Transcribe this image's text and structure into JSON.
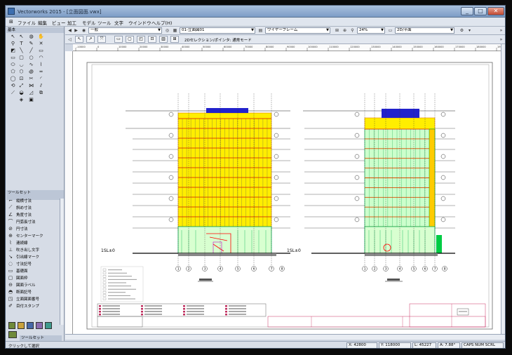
{
  "window": {
    "title": "Vectorworks 2015 - [立面図面.vwx]",
    "btn_min": "_",
    "btn_max": "□",
    "btn_close": "✕"
  },
  "menu": [
    "ファイル",
    "編集",
    "ビュー",
    "加工",
    "モデル",
    "ツール",
    "文字",
    "ウインドウ",
    "ヘルプ(H)"
  ],
  "panels": {
    "basic_title": "基本",
    "toolset_title": "ツールセット",
    "toolset_footer": "ツールセット"
  },
  "toolset_items": [
    "縦横寸法",
    "斜め寸法",
    "角度寸法",
    "円弧長寸法",
    "円寸法",
    "センターマーク",
    "連続線",
    "吹き出し文字",
    "引出線マーク",
    "寸法記号",
    "基礎面",
    "図面枠",
    "図面ラベル",
    "断面記号",
    "立面図面番号",
    "目付スタンプ"
  ],
  "toolbar": {
    "class": "一般",
    "layer": "01-立面図01",
    "render": "ワイヤーフレーム",
    "zoom": "24%",
    "view": "2D/平面"
  },
  "mode_label": "2Dセレクション/ポインタ: 通常モード",
  "ruler_ticks": [
    "-10000",
    "0",
    "10000",
    "20000",
    "30000",
    "40000",
    "50000",
    "60000",
    "70000",
    "80000",
    "90000",
    "100000",
    "110000",
    "120000",
    "130000",
    "140000",
    "150000",
    "160000",
    "170000",
    "180000",
    "190000"
  ],
  "drawing": {
    "level_left": "1SL±0",
    "level_right": "1SL±0",
    "grid_left": [
      "1",
      "2",
      "3",
      "4",
      "5",
      "6",
      "7",
      "8"
    ],
    "grid_right": [
      "1",
      "2",
      "3",
      "4",
      "5",
      "6",
      "7",
      "8"
    ]
  },
  "status": {
    "hint": "クリックして選択",
    "x": "X: 42800",
    "y": "Y: 118000",
    "l": "L: 45227",
    "a": "A: 7.88°",
    "mode": "CAPS NUM SCRL"
  }
}
